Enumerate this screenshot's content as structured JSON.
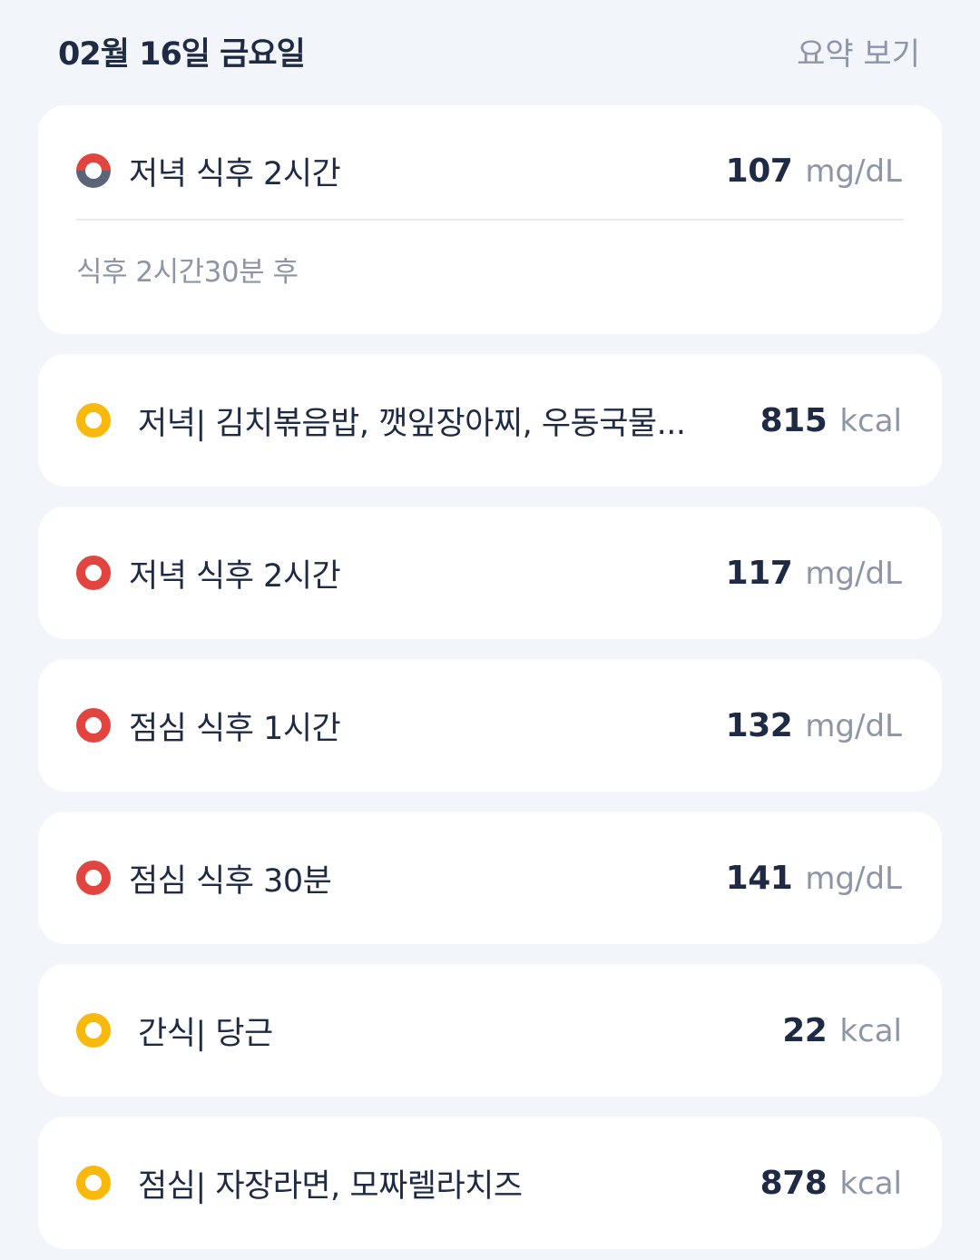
{
  "header": {
    "date": "02월 16일 금요일",
    "summary_link": "요약 보기"
  },
  "colors": {
    "glucose_high": "#e2443f",
    "glucose_normal_part": "#5b6478",
    "meal": "#f9b90c",
    "background": "#f2f5f9",
    "card": "#ffffff",
    "text_primary": "#1f2a44",
    "text_secondary": "#8d95a6"
  },
  "entries": [
    {
      "type": "glucose",
      "indicator": "split-red-gray-ring",
      "label": "저녁 식후 2시간",
      "value": "107",
      "unit": "mg/dL",
      "note": "식후 2시간30분 후"
    },
    {
      "type": "meal",
      "indicator": "yellow-ring",
      "label": "저녁| 김치볶음밥, 깻잎장아찌, 우동국물...",
      "value": "815",
      "unit": "kcal"
    },
    {
      "type": "glucose",
      "indicator": "red-ring",
      "label": "저녁 식후 2시간",
      "value": "117",
      "unit": "mg/dL"
    },
    {
      "type": "glucose",
      "indicator": "red-ring",
      "label": "점심 식후 1시간",
      "value": "132",
      "unit": "mg/dL"
    },
    {
      "type": "glucose",
      "indicator": "red-ring",
      "label": "점심 식후 30분",
      "value": "141",
      "unit": "mg/dL"
    },
    {
      "type": "meal",
      "indicator": "yellow-ring",
      "label": "간식| 당근",
      "value": "22",
      "unit": "kcal"
    },
    {
      "type": "meal",
      "indicator": "yellow-ring",
      "label": "점심| 자장라면, 모짜렐라치즈",
      "value": "878",
      "unit": "kcal"
    }
  ]
}
